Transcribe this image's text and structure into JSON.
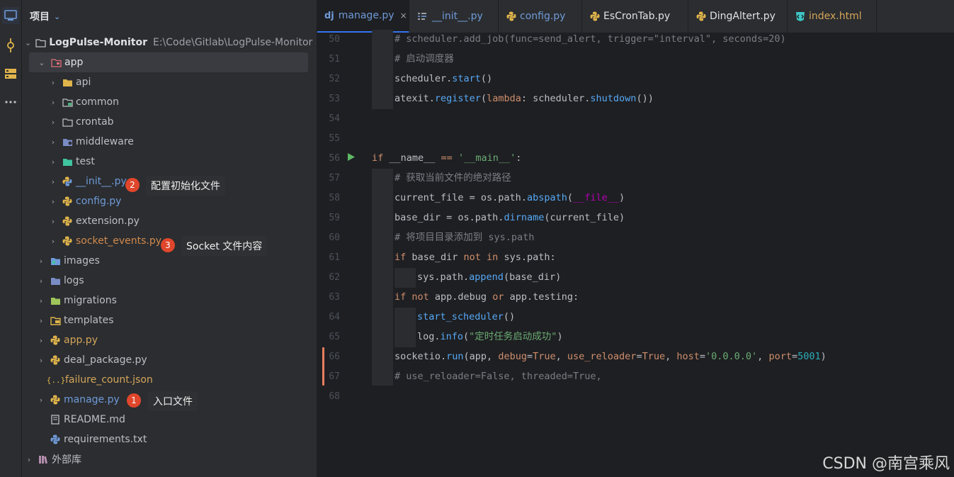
{
  "project_panel": {
    "title": "项目",
    "tree": [
      {
        "label": "LogPulse-Monitor",
        "path": "E:\\Code\\Gitlab\\LogPulse-Monitor",
        "kind": "root"
      },
      {
        "label": "app",
        "kind": "folder-module"
      },
      {
        "label": "api",
        "kind": "folder"
      },
      {
        "label": "common",
        "kind": "folder"
      },
      {
        "label": "crontab",
        "kind": "folder"
      },
      {
        "label": "middleware",
        "kind": "folder"
      },
      {
        "label": "test",
        "kind": "folder"
      },
      {
        "label": "__init__.py",
        "kind": "py"
      },
      {
        "label": "config.py",
        "kind": "py"
      },
      {
        "label": "extension.py",
        "kind": "py"
      },
      {
        "label": "socket_events.py",
        "kind": "py"
      },
      {
        "label": "images",
        "kind": "folder"
      },
      {
        "label": "logs",
        "kind": "folder"
      },
      {
        "label": "migrations",
        "kind": "folder"
      },
      {
        "label": "templates",
        "kind": "folder"
      },
      {
        "label": "app.py",
        "kind": "py"
      },
      {
        "label": "deal_package.py",
        "kind": "py"
      },
      {
        "label": "failure_count.json",
        "kind": "json"
      },
      {
        "label": "manage.py",
        "kind": "py"
      },
      {
        "label": "README.md",
        "kind": "md"
      },
      {
        "label": "requirements.txt",
        "kind": "txt"
      },
      {
        "label": "外部库",
        "kind": "lib"
      }
    ],
    "annotations": [
      {
        "number": "1",
        "text": "入口文件"
      },
      {
        "number": "2",
        "text": "配置初始化文件"
      },
      {
        "number": "3",
        "text": "Socket 文件内容"
      }
    ]
  },
  "tabs": [
    {
      "label": "manage.py",
      "icon": "dj",
      "active": true,
      "close": "×"
    },
    {
      "label": "__init__.py"
    },
    {
      "label": "config.py"
    },
    {
      "label": "EsCronTab.py"
    },
    {
      "label": "DingAltert.py"
    },
    {
      "label": "index.html"
    }
  ],
  "editor": {
    "line_numbers": [
      "50",
      "51",
      "52",
      "53",
      "54",
      "55",
      "56",
      "57",
      "58",
      "59",
      "60",
      "61",
      "62",
      "63",
      "64",
      "65",
      "66",
      "67",
      "68"
    ]
  },
  "code": {
    "l50": "# scheduler.add_job(func=send_alert, trigger=\"interval\", seconds=20)",
    "l51": "# 启动调度器",
    "l52a": "scheduler.",
    "l52b": "start",
    "l52c": "()",
    "l53a": "atexit.",
    "l53b": "register",
    "l53c": "(",
    "l53d": "lambda",
    "l53e": ": scheduler.",
    "l53f": "shutdown",
    "l53g": "())",
    "l56a": "if",
    "l56b": " __name__ ",
    "l56c": "==",
    "l56d": " ",
    "l56e": "'__main__'",
    "l56f": ":",
    "l57": "# 获取当前文件的绝对路径",
    "l58a": "current_file = os.path.",
    "l58b": "abspath",
    "l58c": "(",
    "l58d": "__file__",
    "l58e": ")",
    "l59a": "base_dir = os.path.",
    "l59b": "dirname",
    "l59c": "(current_file)",
    "l60": "# 将项目目录添加到 sys.path",
    "l61a": "if",
    "l61b": " base_dir ",
    "l61c": "not in",
    "l61d": " sys.path:",
    "l62a": "sys.path.",
    "l62b": "append",
    "l62c": "(base_dir)",
    "l63a": "if not",
    "l63b": " app.debug ",
    "l63c": "or",
    "l63d": " app.testing:",
    "l64a": "start_scheduler",
    "l64b": "()",
    "l65a": "log.",
    "l65b": "info",
    "l65c": "(",
    "l65d": "\"定时任务启动成功\"",
    "l65e": ")",
    "l66a": "socketio.",
    "l66b": "run",
    "l66c": "(app, ",
    "l66d": "debug",
    "l66e": "=",
    "l66f": "True",
    "l66g": ", ",
    "l66h": "use_reloader",
    "l66i": "=",
    "l66j": "True",
    "l66k": ", ",
    "l66l": "host",
    "l66m": "=",
    "l66n": "'0.0.0.0'",
    "l66o": ", ",
    "l66p": "port",
    "l66q": "=",
    "l66r": "5001",
    "l66s": ")",
    "l67": "# use_reloader=False, threaded=True,"
  },
  "watermark": "CSDN @南宫乘风",
  "colors": {
    "accent": "#3574f0",
    "badge": "#e0462b",
    "changed_marker": "#e87d5e"
  }
}
